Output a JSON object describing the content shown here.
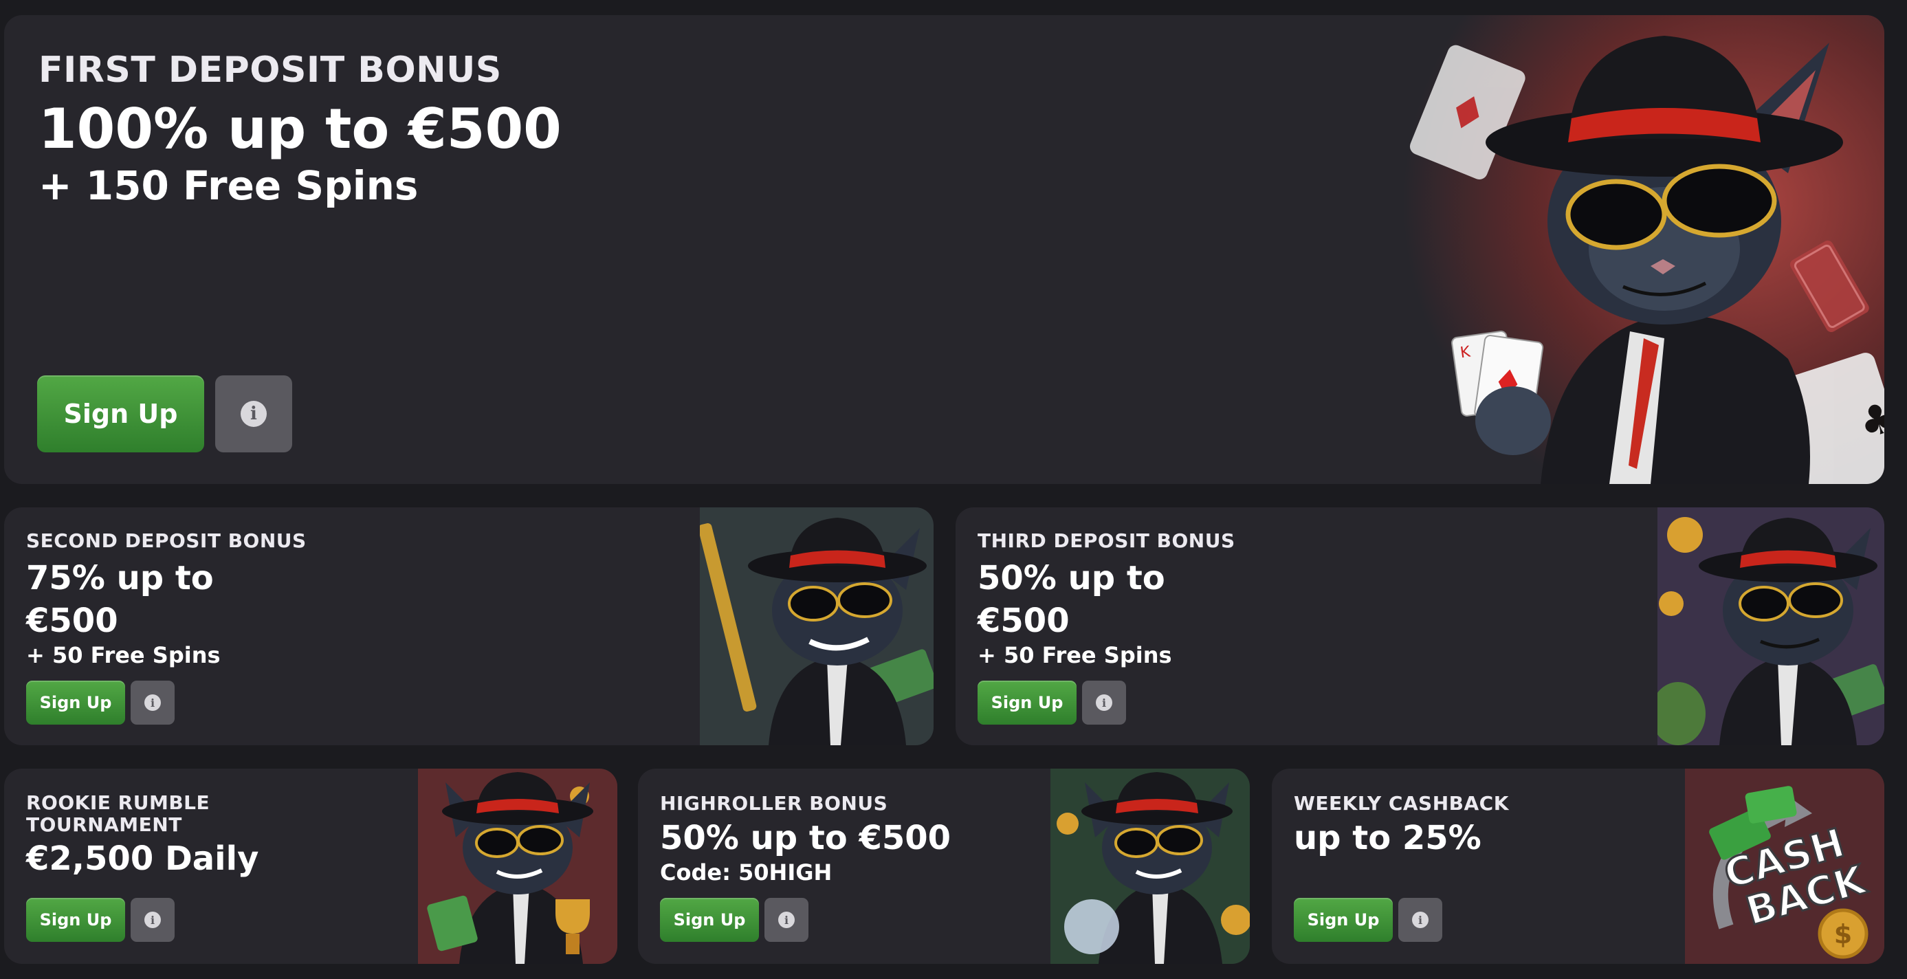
{
  "promotions": {
    "first": {
      "kicker": "FIRST DEPOSIT BONUS",
      "headline": "100% up to €500",
      "sub": "+ 150 Free Spins",
      "signup_label": "Sign Up",
      "info_icon": "info-icon",
      "art": "gangster-cat-with-cards",
      "accent": "#b33b36"
    },
    "second": {
      "kicker": "SECOND DEPOSIT BONUS",
      "headline_line1": "75% up to",
      "headline_line2": "€500",
      "sub": "+ 50 Free Spins",
      "signup_label": "Sign Up",
      "info_icon": "info-icon",
      "art": "gangster-cat-with-rifle",
      "accent": "#3a4a4a"
    },
    "third": {
      "kicker": "THIRD DEPOSIT BONUS",
      "headline_line1": "50% up to",
      "headline_line2": "€500",
      "sub": "+ 50 Free Spins",
      "signup_label": "Sign Up",
      "info_icon": "info-icon",
      "art": "gangster-cat-with-money-bag",
      "accent": "#4a3a5e"
    },
    "rookie": {
      "kicker_line1": "ROOKIE RUMBLE",
      "kicker_line2": "TOURNAMENT",
      "headline": "€2,500 Daily",
      "signup_label": "Sign Up",
      "info_icon": "info-icon",
      "art": "gangster-cat-with-trophy",
      "accent": "#8a2f2f"
    },
    "highroller": {
      "kicker": "HIGHROLLER BONUS",
      "headline": "50% up to €500",
      "sub": "Code: 50HIGH",
      "signup_label": "Sign Up",
      "info_icon": "info-icon",
      "art": "gangster-cat-with-diamond",
      "accent": "#2f5a3a"
    },
    "cashback": {
      "kicker": "WEEKLY CASHBACK",
      "headline": "up to 25%",
      "signup_label": "Sign Up",
      "info_icon": "info-icon",
      "art": "cashback-logo",
      "art_text_line1": "CASH",
      "art_text_line2": "BACK",
      "accent": "#8a2f2f"
    }
  },
  "colors": {
    "page_bg": "#1b1b1f",
    "card_bg": "#27262c",
    "signup_green": "#3f9a37",
    "info_grey": "#5a595f"
  }
}
